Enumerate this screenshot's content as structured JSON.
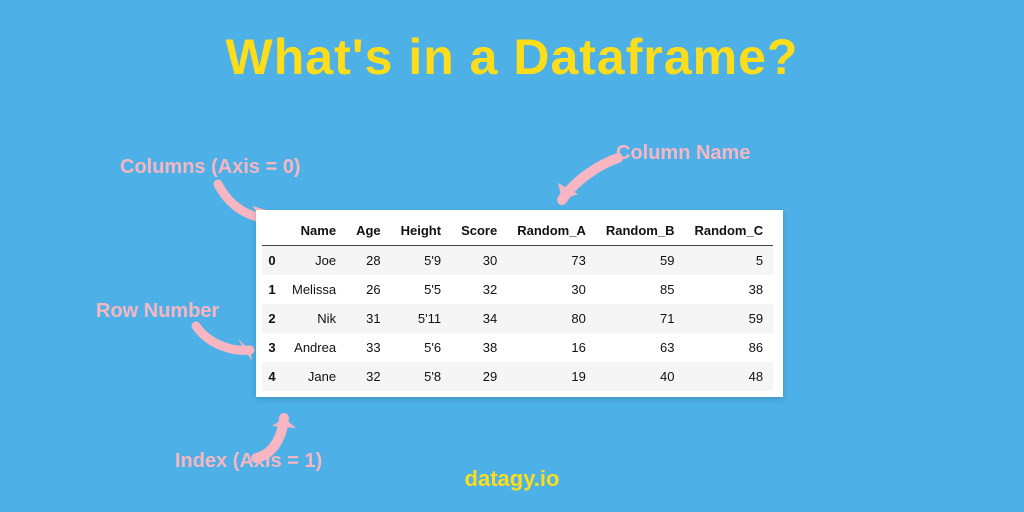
{
  "title": "What's in a Dataframe?",
  "footer": "datagy.io",
  "annotations": {
    "columns": "Columns (Axis = 0)",
    "column_name": "Column Name",
    "row_number": "Row Number",
    "index": "Index (Axis = 1)"
  },
  "table": {
    "headers": [
      "Name",
      "Age",
      "Height",
      "Score",
      "Random_A",
      "Random_B",
      "Random_C"
    ],
    "index": [
      "0",
      "1",
      "2",
      "3",
      "4"
    ],
    "rows": [
      [
        "Joe",
        "28",
        "5'9",
        "30",
        "73",
        "59",
        "5"
      ],
      [
        "Melissa",
        "26",
        "5'5",
        "32",
        "30",
        "85",
        "38"
      ],
      [
        "Nik",
        "31",
        "5'11",
        "34",
        "80",
        "71",
        "59"
      ],
      [
        "Andrea",
        "33",
        "5'6",
        "38",
        "16",
        "63",
        "86"
      ],
      [
        "Jane",
        "32",
        "5'8",
        "29",
        "19",
        "40",
        "48"
      ]
    ]
  },
  "colors": {
    "bg": "#4db0e6",
    "accent": "#ffdd1a",
    "annotation": "#f7b6c2"
  }
}
